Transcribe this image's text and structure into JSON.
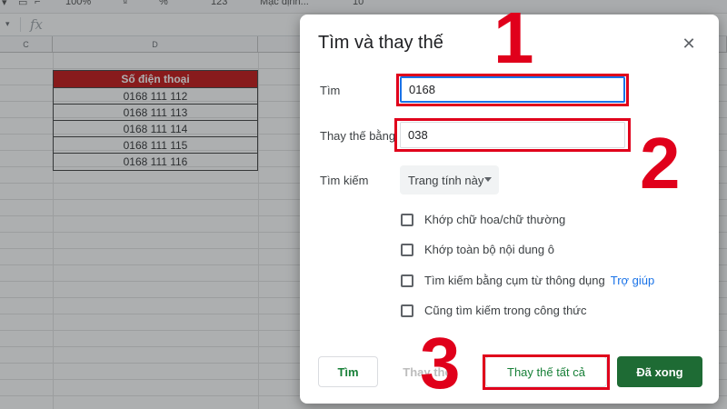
{
  "toolbar": {
    "zoom": "100%",
    "num_format": "123",
    "font": "Mặc định...",
    "font_size": "10"
  },
  "formula_bar": {
    "fx": "fx"
  },
  "columns": {
    "c": "C",
    "d": "D"
  },
  "table": {
    "header": "Số điện thoại",
    "rows": [
      "0168 111 112",
      "0168 111 113",
      "0168 111 114",
      "0168 111 115",
      "0168 111 116"
    ]
  },
  "dialog": {
    "title": "Tìm và thay thế",
    "find_label": "Tìm",
    "find_value": "0168",
    "replace_label": "Thay thế bằng",
    "replace_value": "038",
    "search_label": "Tìm kiếm",
    "search_scope": "Trang tính này",
    "options": [
      "Khớp chữ hoa/chữ thường",
      "Khớp toàn bộ nội dung ô",
      "Tìm kiếm bằng cụm từ thông dụng",
      "Cũng tìm kiếm trong công thức"
    ],
    "help_link": "Trợ giúp",
    "buttons": {
      "find": "Tìm",
      "replace": "Thay thế",
      "replace_all": "Thay thế tất cả",
      "done": "Đã xong"
    }
  },
  "annotations": {
    "one": "1",
    "two": "2",
    "three": "3"
  },
  "colors": {
    "accent_red": "#e0001b",
    "done_green": "#1e6b34",
    "link_blue": "#1a73e8",
    "header_red": "#c00000"
  }
}
